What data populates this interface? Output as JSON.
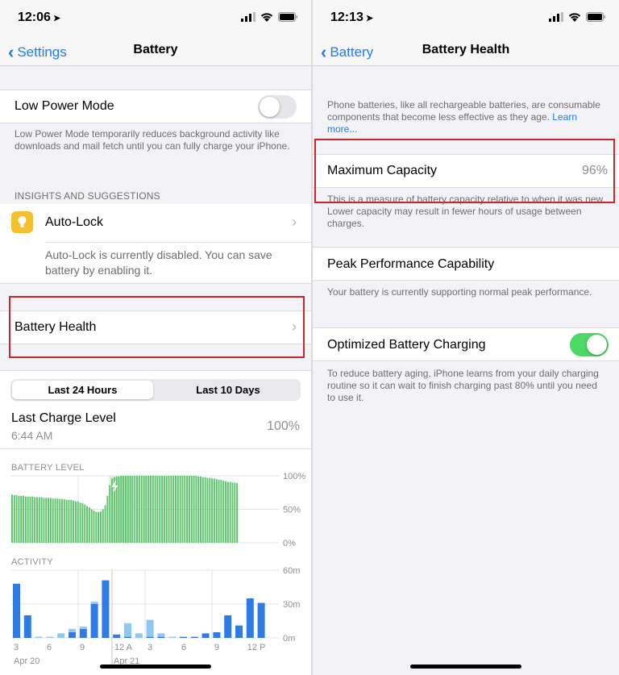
{
  "left": {
    "status": {
      "time": "12:06"
    },
    "nav": {
      "back": "Settings",
      "title": "Battery"
    },
    "low_power": {
      "label": "Low Power Mode",
      "on": false,
      "note": "Low Power Mode temporarily reduces background activity like downloads and mail fetch until you can fully charge your iPhone."
    },
    "insights": {
      "header": "INSIGHTS AND SUGGESTIONS",
      "title": "Auto-Lock",
      "note": "Auto-Lock is currently disabled. You can save battery by enabling it."
    },
    "health": {
      "label": "Battery Health"
    },
    "segments": {
      "first": "Last 24 Hours",
      "second": "Last 10 Days",
      "selected": "Last 24 Hours"
    },
    "last_charge": {
      "label": "Last Charge Level",
      "time": "6:44 AM",
      "value": "100%"
    },
    "battery_level": {
      "header": "BATTERY LEVEL"
    },
    "activity": {
      "header": "ACTIVITY"
    }
  },
  "right": {
    "status": {
      "time": "12:13"
    },
    "nav": {
      "back": "Battery",
      "title": "Battery Health"
    },
    "intro": {
      "text": "Phone batteries, like all rechargeable batteries, are consumable components that become less effective as they age.",
      "link": "Learn more..."
    },
    "max_capacity": {
      "label": "Maximum Capacity",
      "value": "96%",
      "note": "This is a measure of battery capacity relative to when it was new. Lower capacity may result in fewer hours of usage between charges."
    },
    "peak": {
      "label": "Peak Performance Capability",
      "note": "Your battery is currently supporting normal peak performance."
    },
    "optimized": {
      "label": "Optimized Battery Charging",
      "on": true,
      "note": "To reduce battery aging, iPhone learns from your daily charging routine so it can wait to finish charging past 80% until you need to use it."
    }
  },
  "colors": {
    "blue": "#1e7cf2",
    "green": "#4cd964",
    "battery_bar": "#5cc46a",
    "activity_dark": "#2f7ae5",
    "activity_light": "#8fc7ef",
    "highlight": "#d2232a"
  },
  "chart_data": [
    {
      "type": "bar",
      "header": "BATTERY LEVEL",
      "y_ticks": [
        "100%",
        "50%",
        "0%"
      ],
      "ylim": [
        0,
        100
      ],
      "charging_icon": "bolt-icon",
      "charging_range": [
        43,
        53
      ],
      "values": [
        72,
        71,
        71,
        70,
        70,
        70,
        69,
        69,
        69,
        69,
        68,
        68,
        68,
        68,
        67,
        67,
        67,
        67,
        66,
        66,
        66,
        65,
        65,
        65,
        64,
        64,
        64,
        63,
        62,
        62,
        60,
        59,
        57,
        55,
        53,
        50,
        48,
        46,
        46,
        47,
        50,
        56,
        70,
        86,
        96,
        98,
        99,
        99,
        100,
        100,
        100,
        100,
        100,
        100,
        100,
        100,
        100,
        100,
        100,
        100,
        100,
        100,
        100,
        100,
        100,
        100,
        100,
        100,
        100,
        100,
        100,
        100,
        100,
        100,
        100,
        100,
        100,
        100,
        100,
        100,
        100,
        100,
        99,
        99,
        98,
        98,
        97,
        97,
        96,
        96,
        95,
        94,
        94,
        93,
        92,
        91,
        91,
        90,
        90,
        89
      ]
    },
    {
      "type": "bar",
      "header": "ACTIVITY",
      "y_ticks": [
        "60m",
        "30m",
        "0m"
      ],
      "ylim": [
        0,
        60
      ],
      "x_ticks": [
        "3",
        "6",
        "9",
        "12 A",
        "3",
        "6",
        "9",
        "12 P"
      ],
      "date_labels": [
        "Apr 20",
        "Apr 21"
      ],
      "series": [
        {
          "values": [
            48,
            20,
            0,
            0,
            0,
            5,
            8,
            30,
            51,
            3,
            1,
            0,
            1,
            1,
            0,
            1,
            1,
            4,
            5,
            20,
            11,
            35,
            31
          ]
        },
        {
          "values": [
            0,
            0,
            1,
            1,
            4,
            3,
            2,
            2,
            0,
            0,
            12,
            4,
            15,
            3,
            1,
            0,
            0,
            0,
            0,
            0,
            0,
            0,
            0
          ]
        }
      ]
    }
  ]
}
